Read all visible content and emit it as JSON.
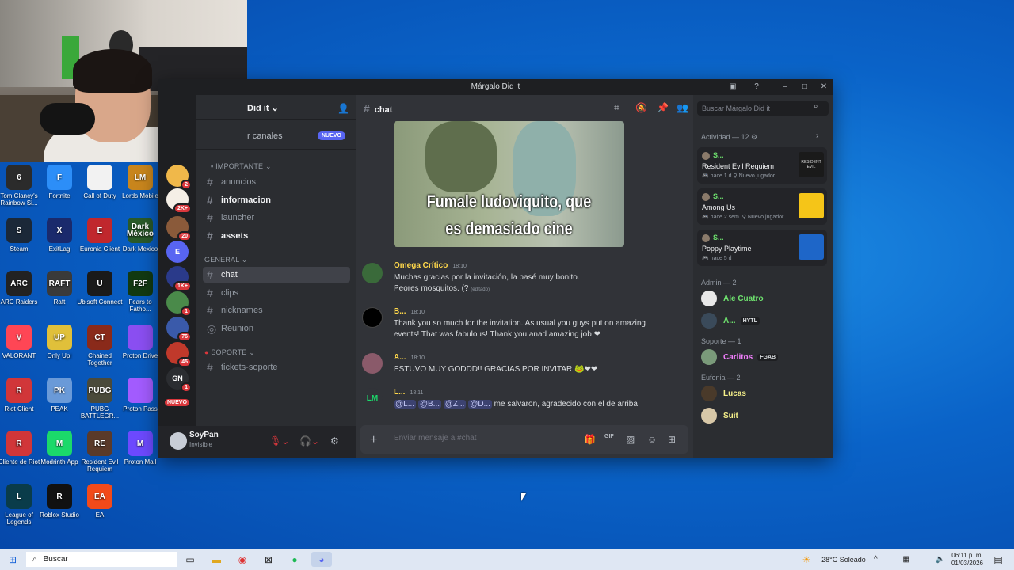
{
  "desktop": {
    "icons": [
      {
        "label": "Tom Clancy's Rainbow Si...",
        "glyph": "6",
        "color": "#2b2b2b"
      },
      {
        "label": "Fortnite",
        "glyph": "F",
        "color": "#2c8ef8"
      },
      {
        "label": "Call of Duty",
        "glyph": "",
        "color": "#f2f2f2"
      },
      {
        "label": "Lords Mobile",
        "glyph": "LM",
        "color": "#c9861d"
      },
      {
        "label": "Steam",
        "glyph": "S",
        "color": "#1b2838"
      },
      {
        "label": "ExitLag",
        "glyph": "X",
        "color": "#1a2a6c"
      },
      {
        "label": "Euronia Client",
        "glyph": "E",
        "color": "#c0272d"
      },
      {
        "label": "Dark Mexico",
        "glyph": "Dark México",
        "color": "#2a5a2a"
      },
      {
        "label": "ARC Raiders",
        "glyph": "ARC",
        "color": "#222"
      },
      {
        "label": "Raft",
        "glyph": "RAFT",
        "color": "#3a3a3a"
      },
      {
        "label": "Ubisoft Connect",
        "glyph": "U",
        "color": "#1a1a1a"
      },
      {
        "label": "Fears to Fatho...",
        "glyph": "F2F",
        "color": "#123a12"
      },
      {
        "label": "VALORANT",
        "glyph": "V",
        "color": "#ff4655"
      },
      {
        "label": "Only Up!",
        "glyph": "UP",
        "color": "#e0c03a"
      },
      {
        "label": "Chained Together",
        "glyph": "CT",
        "color": "#8a2a1a"
      },
      {
        "label": "Proton Drive",
        "glyph": "",
        "color": "#8b4ff2"
      },
      {
        "label": "Riot Client",
        "glyph": "R",
        "color": "#d13639"
      },
      {
        "label": "PEAK",
        "glyph": "PK",
        "color": "#6a9ad8"
      },
      {
        "label": "PUBG BATTLEGR...",
        "glyph": "PUBG",
        "color": "#4a4a3a"
      },
      {
        "label": "Proton Pass",
        "glyph": "",
        "color": "#a35cff"
      },
      {
        "label": "Cliente de Riot",
        "glyph": "R",
        "color": "#d13639"
      },
      {
        "label": "Modrinth App",
        "glyph": "M",
        "color": "#1bd96a"
      },
      {
        "label": "Resident Evil Requiem",
        "glyph": "RE",
        "color": "#5a3a2a"
      },
      {
        "label": "Proton Mail",
        "glyph": "M",
        "color": "#6d4aff"
      },
      {
        "label": "League of Legends",
        "glyph": "L",
        "color": "#0a3c4a"
      },
      {
        "label": "Roblox Studio",
        "glyph": "R",
        "color": "#111"
      },
      {
        "label": "EA",
        "glyph": "EA",
        "color": "#f24a1a"
      }
    ]
  },
  "window": {
    "title": "Márgalo Did it",
    "server_name": "Did it",
    "browse_channels": "r canales",
    "new_badge": "NUEVO",
    "categories": {
      "importante": "IMPORTANTE",
      "general": "GENERAL",
      "soporte": "SOPORTE"
    },
    "channels": {
      "anuncios": "anuncios",
      "informacion": "informacion",
      "launcher": "launcher",
      "assets": "assets",
      "chat": "chat",
      "clips": "clips",
      "nicknames": "nicknames",
      "reunion": "Reunion",
      "tickets": "tickets-soporte"
    },
    "servers": [
      {
        "badge": "2",
        "color": "#f0b84a"
      },
      {
        "badge": "2K+",
        "color": "#f5efe6"
      },
      {
        "badge": "20",
        "color": "#8a5a3a"
      },
      {
        "badge": "",
        "color": "#5865f2",
        "glyph": "E"
      },
      {
        "badge": "1K+",
        "color": "#2a3a8a"
      },
      {
        "badge": "1",
        "color": "#4a8a4a"
      },
      {
        "badge": "76",
        "color": "#3a5aaa"
      },
      {
        "badge": "45",
        "color": "#c0392b"
      },
      {
        "badge": "1",
        "color": "#2b2d31",
        "glyph": "GN"
      },
      {
        "badge": "NUEVO",
        "color": "#da373c"
      }
    ],
    "user": {
      "name": "SoyPan",
      "status": "Invisible"
    },
    "chat": {
      "channel": "chat",
      "gif_caption_1": "Fumale ludoviquito, que",
      "gif_caption_2": "es demasiado cine",
      "messages": [
        {
          "author": "Omega Crítico",
          "time": "18:10",
          "color": "#ffd84a",
          "lines": [
            "Muchas gracias por la invitación, la pasé muy bonito.",
            "Peores mosquitos. (?"
          ],
          "edited": "(editado)"
        },
        {
          "author": "B...",
          "time": "18:10",
          "color": "#ffd84a",
          "lines": [
            "Thank you so much for the invitation. As usual you guys put on amazing",
            "events! That was fabulous! Thank you anad amazing job ❤"
          ]
        },
        {
          "author": "A...",
          "time": "18:10",
          "color": "#ffd84a",
          "lines": [
            "ESTUVO MUY GODDD!! GRACIAS POR INVITAR 🐸❤❤"
          ]
        },
        {
          "author": "L...",
          "time": "18:11",
          "color": "#ffd84a",
          "mentions": [
            "@L...",
            "@B...",
            "@Z...",
            "@D..."
          ],
          "tail": "me salvaron, agradecido con el de arriba"
        }
      ],
      "placeholder": "Enviar mensaje a #chat"
    },
    "search_placeholder": "Buscar Márgalo Did it",
    "activity": {
      "header": "Actividad — 12",
      "cards": [
        {
          "user": "S...",
          "game": "Resident Evil Requiem",
          "meta": "hace 1 d",
          "tag": "Nuevo jugador",
          "art": "RESIDENT EVIL",
          "artcolor": "#1a1a1a"
        },
        {
          "user": "S...",
          "game": "Among Us",
          "meta": "hace 2 sem.",
          "tag": "Nuevo jugador",
          "art": "",
          "artcolor": "#f5c518"
        },
        {
          "user": "S...",
          "game": "Poppy Playtime",
          "meta": "hace 5 d",
          "tag": "",
          "art": "",
          "artcolor": "#1e66c8"
        }
      ]
    },
    "member_groups": [
      {
        "title": "Admin — 2",
        "members": [
          {
            "name": "Ale Cuatro",
            "color": "#6ee26e",
            "tag": ""
          },
          {
            "name": "A...",
            "color": "#6ee26e",
            "tag": "HYTL"
          }
        ]
      },
      {
        "title": "Soporte — 1",
        "members": [
          {
            "name": "Carlitos",
            "color": "#f47fff",
            "tag": "FGAB"
          }
        ]
      },
      {
        "title": "Eufonia — 2",
        "members": [
          {
            "name": "Lucas",
            "color": "#f6f08a",
            "tag": ""
          },
          {
            "name": "Suit",
            "color": "#f6f08a",
            "tag": ""
          }
        ]
      }
    ]
  },
  "taskbar": {
    "search": "Buscar",
    "weather": "28°C  Soleado",
    "time": "06:11 p. m.",
    "date": "01/03/2026"
  }
}
